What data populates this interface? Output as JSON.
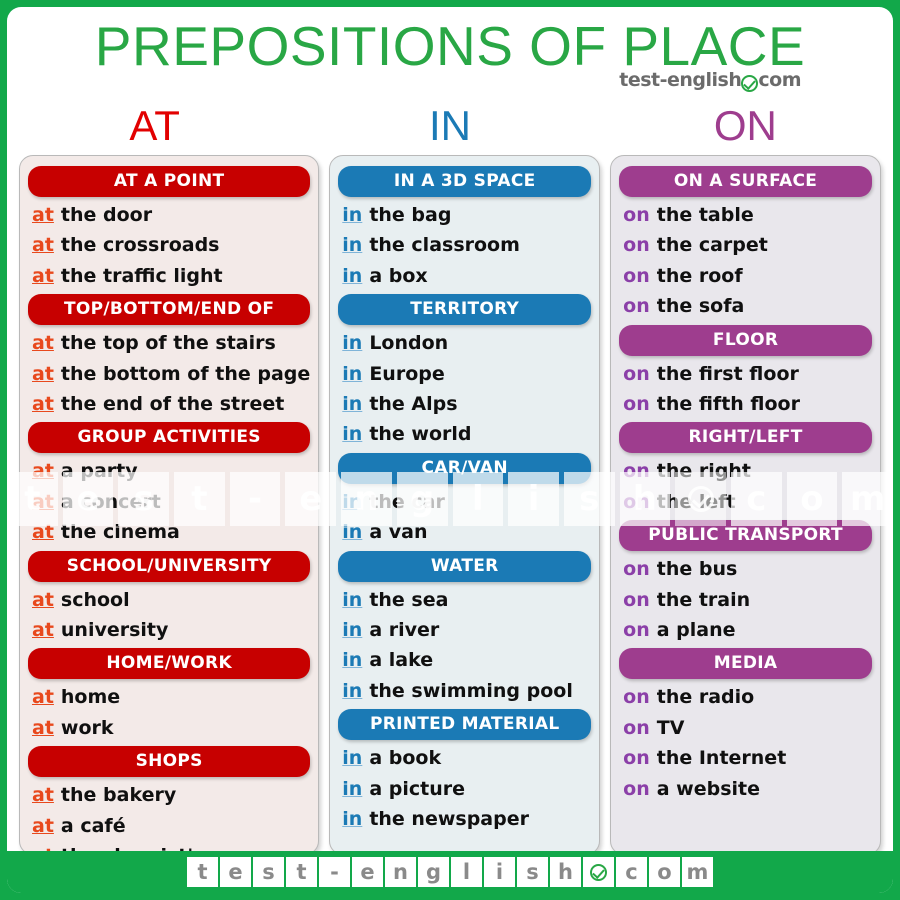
{
  "poster": {
    "title": "PREPOSITIONS OF PLACE",
    "brand": {
      "left": "test-english",
      "right": "com",
      "icon": "check-circle-icon"
    },
    "colors": {
      "frame_green": "#12a84a",
      "title_green": "#29a745",
      "at_red": "#e20000",
      "at_header_red": "#c70000",
      "at_card_bg": "#f3eae8",
      "in_blue": "#1b7ab5",
      "in_card_bg": "#e8eff1",
      "on_purple": "#9e3d8e",
      "on_card_bg": "#e9e7ec"
    }
  },
  "columns": [
    {
      "id": "at",
      "title": "AT",
      "preposition": "at",
      "sections": [
        {
          "header": "AT A POINT",
          "items": [
            {
              "prep": "at",
              "text": "the door"
            },
            {
              "prep": "at",
              "text": "the crossroads"
            },
            {
              "prep": "at",
              "text": "the traffic light"
            }
          ]
        },
        {
          "header": "TOP/BOTTOM/END OF",
          "items": [
            {
              "prep": "at",
              "text": "the top  of the stairs"
            },
            {
              "prep": "at",
              "text": "the bottom of the page"
            },
            {
              "prep": "at",
              "text": "the end of the street"
            }
          ]
        },
        {
          "header": "GROUP ACTIVITIES",
          "items": [
            {
              "prep": "at",
              "text": "a party"
            },
            {
              "prep": "at",
              "text": "a concert"
            },
            {
              "prep": "at",
              "text": "the cinema"
            }
          ]
        },
        {
          "header": "SCHOOL/UNIVERSITY",
          "items": [
            {
              "prep": "at",
              "text": "school"
            },
            {
              "prep": "at",
              "text": "university"
            }
          ]
        },
        {
          "header": "HOME/WORK",
          "items": [
            {
              "prep": "at",
              "text": "home"
            },
            {
              "prep": "at",
              "text": "work"
            }
          ]
        },
        {
          "header": "SHOPS",
          "items": [
            {
              "prep": "at",
              "text": "the bakery"
            },
            {
              "prep": "at",
              "text": "a café"
            },
            {
              "prep": "at",
              "text": "the chemist's"
            }
          ]
        }
      ]
    },
    {
      "id": "in",
      "title": "IN",
      "preposition": "in",
      "sections": [
        {
          "header": "IN A 3D SPACE",
          "items": [
            {
              "prep": "in",
              "text": "the bag"
            },
            {
              "prep": "in",
              "text": "the classroom"
            },
            {
              "prep": "in",
              "text": "a box"
            }
          ]
        },
        {
          "header": "TERRITORY",
          "items": [
            {
              "prep": "in",
              "text": "London"
            },
            {
              "prep": "in",
              "text": "Europe"
            },
            {
              "prep": "in",
              "text": "the Alps"
            },
            {
              "prep": "in",
              "text": "the world"
            }
          ]
        },
        {
          "header": "CAR/VAN",
          "items": [
            {
              "prep": "in",
              "text": "the car"
            },
            {
              "prep": "in",
              "text": "a van"
            }
          ]
        },
        {
          "header": "WATER",
          "items": [
            {
              "prep": "in",
              "text": "the sea"
            },
            {
              "prep": "in",
              "text": "a river"
            },
            {
              "prep": "in",
              "text": "a lake"
            },
            {
              "prep": "in",
              "text": "the swimming pool"
            }
          ]
        },
        {
          "header": "PRINTED MATERIAL",
          "items": [
            {
              "prep": "in",
              "text": "a book"
            },
            {
              "prep": "in",
              "text": "a picture"
            },
            {
              "prep": "in",
              "text": "the newspaper"
            }
          ]
        }
      ]
    },
    {
      "id": "on",
      "title": "ON",
      "preposition": "on",
      "sections": [
        {
          "header": "ON A SURFACE",
          "items": [
            {
              "prep": "on",
              "text": "the table"
            },
            {
              "prep": "on",
              "text": "the carpet"
            },
            {
              "prep": "on",
              "text": "the roof"
            },
            {
              "prep": "on",
              "text": "the sofa"
            }
          ]
        },
        {
          "header": "FLOOR",
          "items": [
            {
              "prep": "on",
              "text": "the first floor"
            },
            {
              "prep": "on",
              "text": "the fifth floor"
            }
          ]
        },
        {
          "header": "RIGHT/LEFT",
          "items": [
            {
              "prep": "on",
              "text": "the right"
            },
            {
              "prep": "on",
              "text": "the left"
            }
          ]
        },
        {
          "header": "PUBLIC TRANSPORT",
          "items": [
            {
              "prep": "on",
              "text": "the bus"
            },
            {
              "prep": "on",
              "text": "the train"
            },
            {
              "prep": "on",
              "text": "a plane"
            }
          ]
        },
        {
          "header": "MEDIA",
          "items": [
            {
              "prep": "on",
              "text": "the radio"
            },
            {
              "prep": "on",
              "text": "TV"
            },
            {
              "prep": "on",
              "text": "the Internet"
            },
            {
              "prep": "on",
              "text": "a website"
            }
          ]
        }
      ]
    }
  ],
  "watermark": {
    "cells": [
      "t",
      "e",
      "s",
      "t",
      "-",
      "e",
      "n",
      "g",
      "l",
      "i",
      "s",
      "h",
      "check",
      "c",
      "o",
      "m"
    ]
  },
  "footer": {
    "cells": [
      "t",
      "e",
      "s",
      "t",
      "-",
      "e",
      "n",
      "g",
      "l",
      "i",
      "s",
      "h",
      "check",
      "c",
      "o",
      "m"
    ]
  }
}
